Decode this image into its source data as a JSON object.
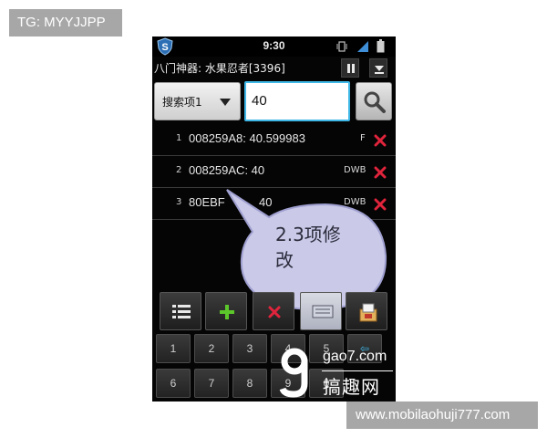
{
  "overlay": {
    "tg_label": "TG: MYYJJPP",
    "url_label": "www.mobilaohuji777.com"
  },
  "status_bar": {
    "time": "9:30",
    "icons": [
      "app-shield-icon",
      "vibrate-icon",
      "signal-icon",
      "battery-icon"
    ]
  },
  "header": {
    "title": "八门神器: 水果忍者[3396]",
    "buttons": [
      "pause-icon",
      "menu-down-icon"
    ]
  },
  "search": {
    "type_label": "搜索项1",
    "value": "40"
  },
  "results": [
    {
      "index": "1",
      "text": "008259A8: 40.599983",
      "type": "F"
    },
    {
      "index": "2",
      "text": "008259AC: 40",
      "type": "DWB"
    },
    {
      "index": "3",
      "text": "80EBF",
      "value_tail": "40",
      "type": "DWB"
    }
  ],
  "callout": {
    "line1": "2.3项修",
    "line2": "改"
  },
  "toolbar": {
    "buttons": [
      "list-icon",
      "add-icon",
      "delete-icon",
      "keyboard-icon",
      "clipboard-icon"
    ]
  },
  "keypad": {
    "row1": [
      "1",
      "2",
      "3",
      "4",
      "5"
    ],
    "row2": [
      "6",
      "7",
      "8",
      "9",
      "0"
    ]
  },
  "watermark": {
    "domain": "gao7.com",
    "name": "搞趣网"
  },
  "colors": {
    "accent": "#3fb8e8",
    "delete_red": "#e0243c",
    "add_green": "#5cc72a",
    "callout_fill": "#cac9e8"
  }
}
